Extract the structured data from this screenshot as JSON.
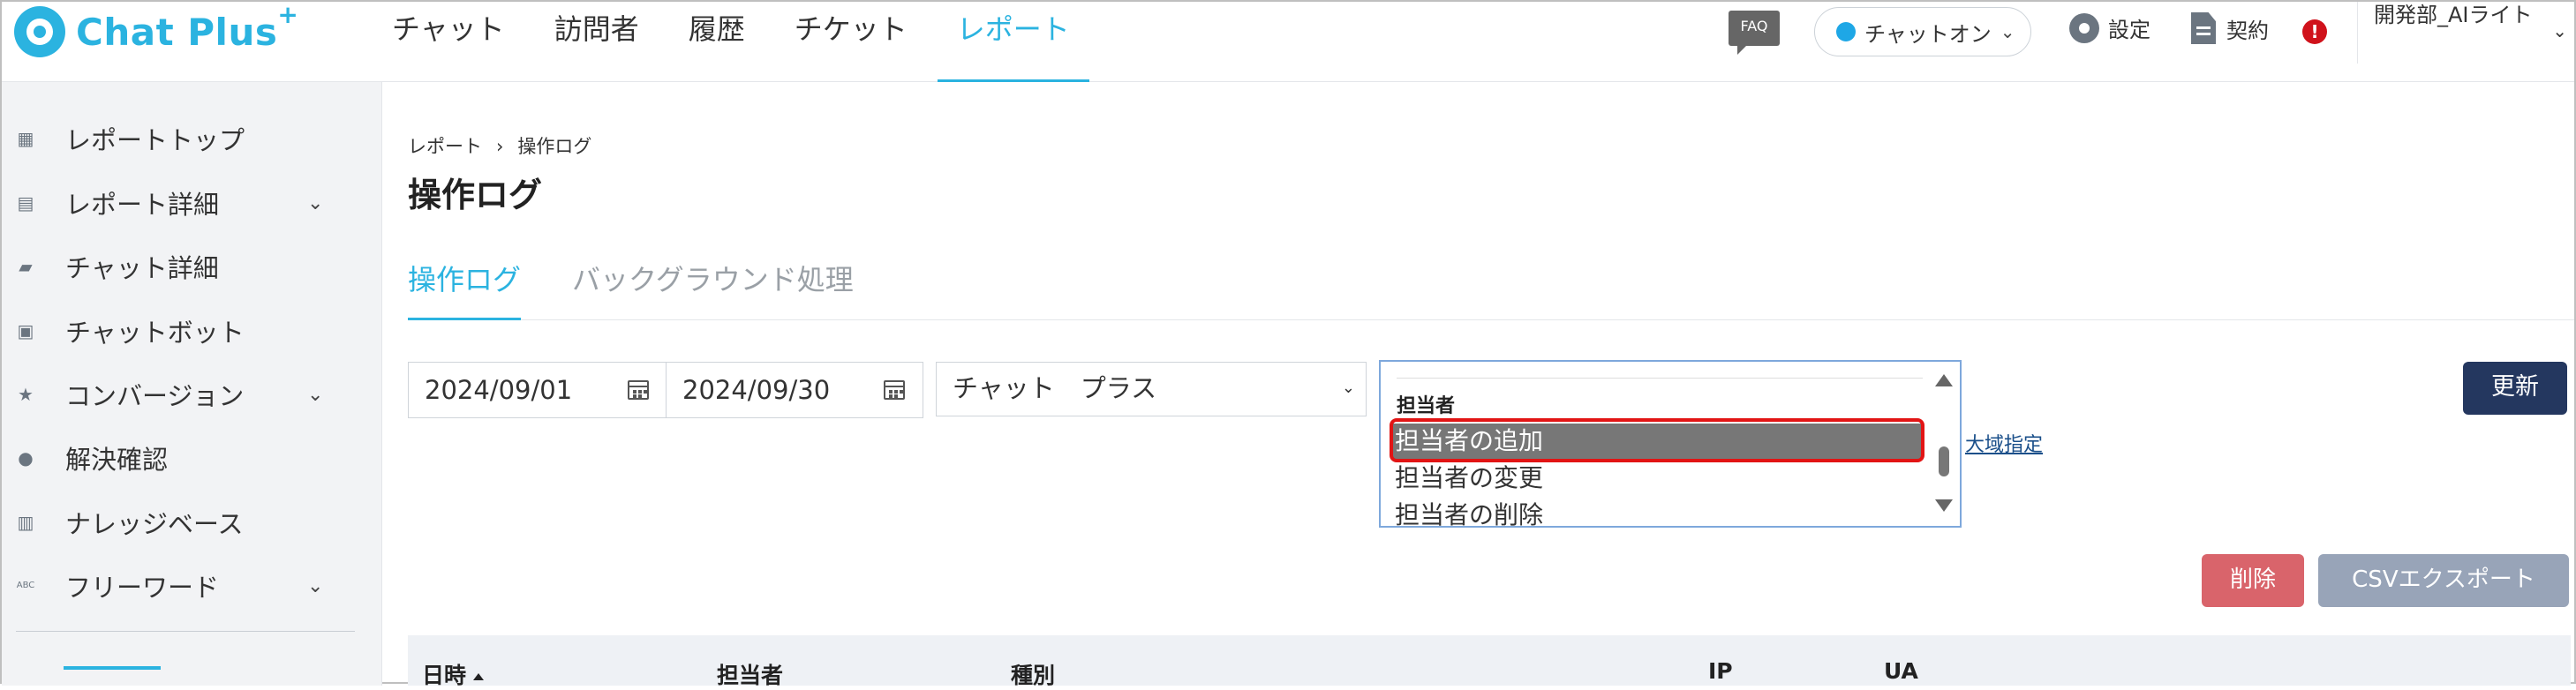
{
  "app": {
    "logo_text": "Chat Plus",
    "logo_sup": "+"
  },
  "nav": {
    "items": [
      {
        "label": "チャット"
      },
      {
        "label": "訪問者"
      },
      {
        "label": "履歴"
      },
      {
        "label": "チケット"
      },
      {
        "label": "レポート",
        "active": true
      }
    ]
  },
  "header": {
    "faq": "FAQ",
    "status": "チャットオン",
    "settings": "設定",
    "contract": "契約",
    "alert": "!",
    "user": "開発部_AIライト"
  },
  "sidebar": {
    "items": [
      {
        "label": "レポートトップ",
        "icon": "dashboard-icon",
        "chevron": false
      },
      {
        "label": "レポート詳細",
        "icon": "chart-icon",
        "chevron": true
      },
      {
        "label": "チャット詳細",
        "icon": "chat-icon",
        "chevron": false
      },
      {
        "label": "チャットボット",
        "icon": "bot-icon",
        "chevron": false
      },
      {
        "label": "コンバージョン",
        "icon": "star-icon",
        "chevron": true
      },
      {
        "label": "解決確認",
        "icon": "bulb-icon",
        "chevron": false
      },
      {
        "label": "ナレッジベース",
        "icon": "book-icon",
        "chevron": false
      },
      {
        "label": "フリーワード",
        "icon": "abc-icon",
        "chevron": true
      }
    ]
  },
  "breadcrumb": {
    "parent": "レポート",
    "separator": "›",
    "current": "操作ログ"
  },
  "page_title": "操作ログ",
  "tabs": [
    {
      "label": "操作ログ",
      "active": true
    },
    {
      "label": "バックグラウンド処理",
      "active": false
    }
  ],
  "filters": {
    "date_from": "2024/09/01",
    "date_to": "2024/09/30",
    "site_select": "チャット　プラス",
    "listbox": {
      "group_label": "担当者",
      "options": [
        "担当者の追加",
        "担当者の変更",
        "担当者の削除"
      ],
      "selected": "担当者の追加"
    },
    "wide_range_link": "大域指定"
  },
  "buttons": {
    "update": "更新",
    "delete": "削除",
    "csv": "CSVエクスポート"
  },
  "table": {
    "headers": [
      "日時",
      "担当者",
      "種別",
      "IP",
      "UA"
    ]
  }
}
